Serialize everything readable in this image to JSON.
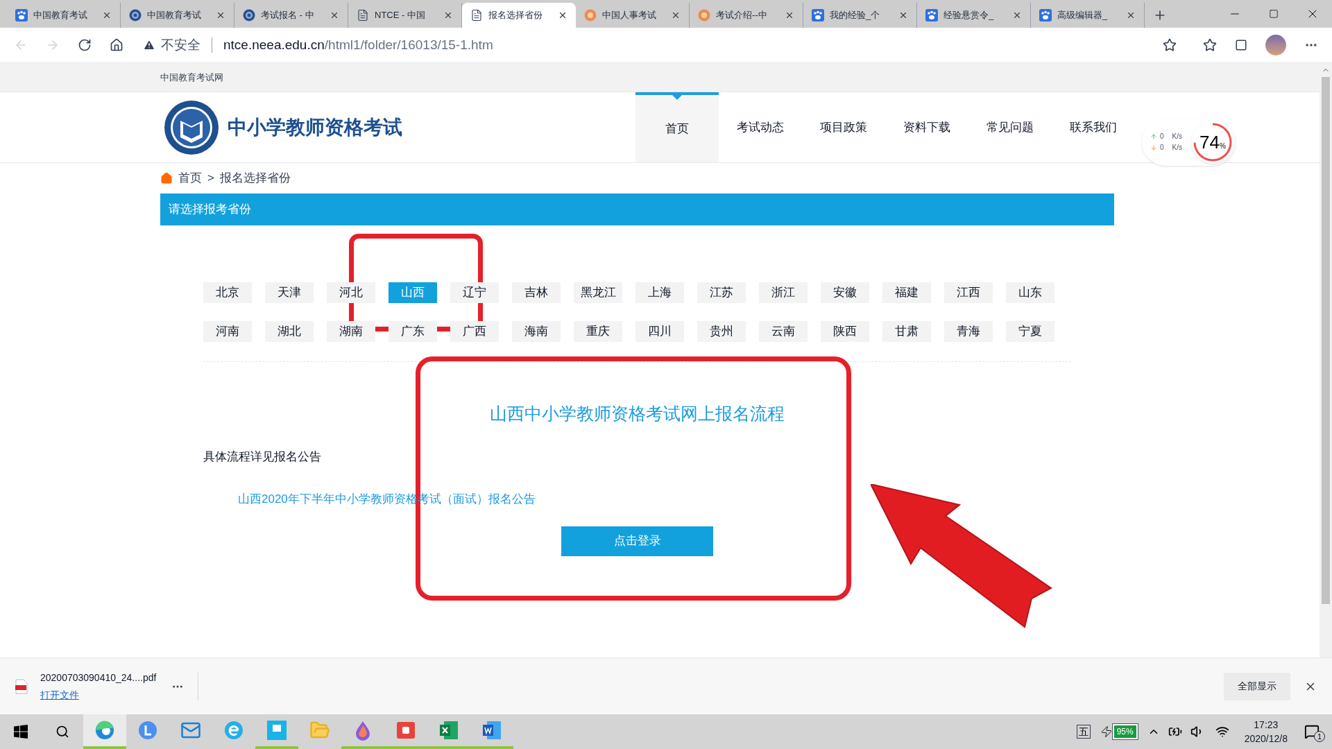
{
  "browser": {
    "tabs": [
      {
        "title": "中国教育考试",
        "kind": "paw",
        "selected": false
      },
      {
        "title": "中国教育考试",
        "kind": "seal",
        "selected": false
      },
      {
        "title": "考试报名 - 中",
        "kind": "seal",
        "selected": false
      },
      {
        "title": "NTCE - 中国",
        "kind": "page",
        "selected": false
      },
      {
        "title": "报名选择省份",
        "kind": "page",
        "selected": true
      },
      {
        "title": "中国人事考试",
        "kind": "orange",
        "selected": false
      },
      {
        "title": "考试介绍--中",
        "kind": "orange",
        "selected": false
      },
      {
        "title": "我的经验_个",
        "kind": "paw",
        "selected": false
      },
      {
        "title": "经验悬赏令_",
        "kind": "paw",
        "selected": false
      },
      {
        "title": "高级编辑器_",
        "kind": "paw",
        "selected": false
      }
    ],
    "address": {
      "security": "不安全",
      "host": "ntce.neea.edu.cn",
      "path": "/html1/folder/16013/15-1.htm"
    }
  },
  "page": {
    "site_name": "中国教育考试网",
    "title": "中小学教师资格考试",
    "nav": [
      {
        "label": "首页",
        "selected": true
      },
      {
        "label": "考试动态",
        "selected": false
      },
      {
        "label": "项目政策",
        "selected": false
      },
      {
        "label": "资料下载",
        "selected": false
      },
      {
        "label": "常见问题",
        "selected": false
      },
      {
        "label": "联系我们",
        "selected": false
      }
    ],
    "speed_widget": {
      "up": "0",
      "down": "0",
      "unit_up": "K/s",
      "unit_down": "K/s",
      "percent": "74",
      "percent_sign": "%"
    },
    "breadcrumb": {
      "home": "首页",
      "separator": ">",
      "current": "报名选择省份"
    },
    "section_title": "请选择报考省份",
    "provinces": [
      {
        "name": "北京",
        "selected": false
      },
      {
        "name": "天津",
        "selected": false
      },
      {
        "name": "河北",
        "selected": false
      },
      {
        "name": "山西",
        "selected": true
      },
      {
        "name": "辽宁",
        "selected": false
      },
      {
        "name": "吉林",
        "selected": false
      },
      {
        "name": "黑龙江",
        "selected": false
      },
      {
        "name": "上海",
        "selected": false
      },
      {
        "name": "江苏",
        "selected": false
      },
      {
        "name": "浙江",
        "selected": false
      },
      {
        "name": "安徽",
        "selected": false
      },
      {
        "name": "福建",
        "selected": false
      },
      {
        "name": "江西",
        "selected": false
      },
      {
        "name": "山东",
        "selected": false
      },
      {
        "name": "河南",
        "selected": false
      },
      {
        "name": "湖北",
        "selected": false
      },
      {
        "name": "湖南",
        "selected": false
      },
      {
        "name": "广东",
        "selected": false
      },
      {
        "name": "广西",
        "selected": false
      },
      {
        "name": "海南",
        "selected": false
      },
      {
        "name": "重庆",
        "selected": false
      },
      {
        "name": "四川",
        "selected": false
      },
      {
        "name": "贵州",
        "selected": false
      },
      {
        "name": "云南",
        "selected": false
      },
      {
        "name": "陕西",
        "selected": false
      },
      {
        "name": "甘肃",
        "selected": false
      },
      {
        "name": "青海",
        "selected": false
      },
      {
        "name": "宁夏",
        "selected": false
      }
    ],
    "flow_title": "山西中小学教师资格考试网上报名流程",
    "note": "具体流程详见报名公告",
    "notice_link": "山西2020年下半年中小学教师资格考试（面试）报名公告",
    "login_button": "点击登录"
  },
  "download_bar": {
    "file_name": "20200703090410_24....pdf",
    "open_link": "打开文件",
    "show_all": "全部显示"
  },
  "taskbar": {
    "ime": "五",
    "battery": "95%",
    "time": "17:23",
    "date": "2020/12/8",
    "notifications": "1"
  }
}
